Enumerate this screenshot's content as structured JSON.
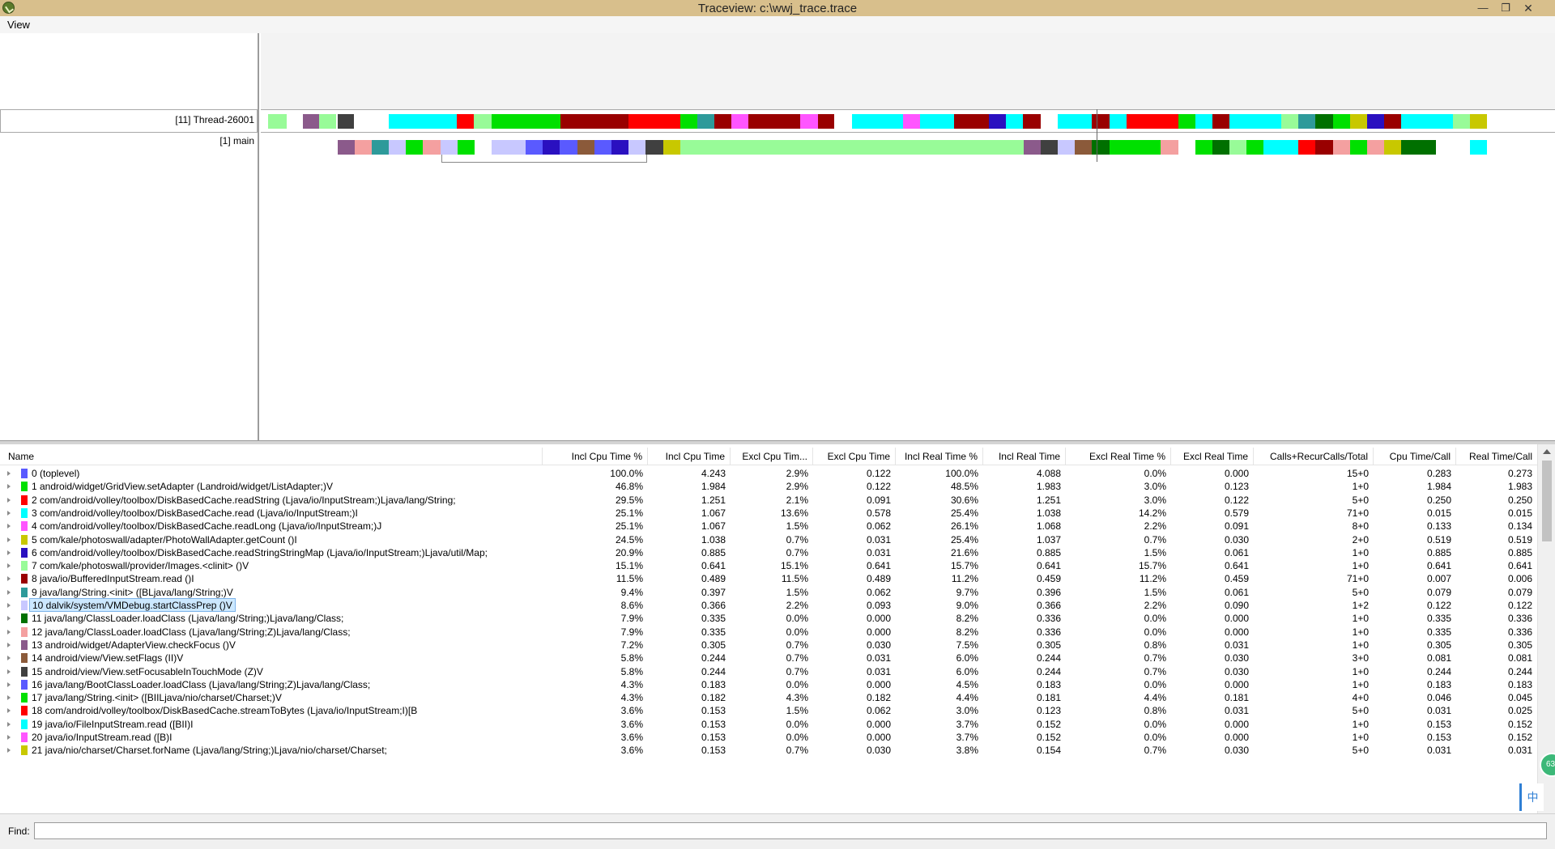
{
  "window": {
    "title": "Traceview: c:\\wwj_trace.trace",
    "minimize_glyph": "—",
    "maximize_glyph": "❐",
    "close_glyph": "✕",
    "app_icon": "android-traceview-icon"
  },
  "menu": {
    "items": [
      {
        "label": "View"
      }
    ]
  },
  "timeline": {
    "threads": [
      {
        "label": "[11] Thread-26001"
      },
      {
        "label": "[1] main"
      }
    ],
    "strip_colors": {
      "lime": "#98fb98",
      "purple": "#8b5a8b",
      "dark": "#404040",
      "cyan": "#00ffff",
      "red": "#ff0000",
      "green": "#00e000",
      "maroon": "#990000",
      "teal": "#2e9a9a",
      "magenta": "#ff55ff",
      "navy": "#2a10c0",
      "pink": "#f4a0a0",
      "lavender": "#c8c8ff",
      "blue": "#5a5aff",
      "brown": "#8b5a3a",
      "olive": "#c8c800",
      "darkgreen": "#007000"
    }
  },
  "table": {
    "headers": {
      "name": "Name",
      "incl_cpu_pct": "Incl Cpu Time %",
      "incl_cpu": "Incl Cpu Time",
      "excl_cpu_pct": "Excl Cpu Tim...",
      "excl_cpu": "Excl Cpu Time",
      "incl_real_pct": "Incl Real Time %",
      "incl_real": "Incl Real Time",
      "excl_real_pct": "Excl Real Time %",
      "excl_real": "Excl Real Time",
      "calls": "Calls+RecurCalls/Total",
      "cpu_per_call": "Cpu Time/Call",
      "real_per_call": "Real Time/Call"
    },
    "selected_index": 10,
    "rows": [
      {
        "name": "0 (toplevel)",
        "color": "#5a5aff",
        "v": [
          "100.0%",
          "4.243",
          "2.9%",
          "0.122",
          "100.0%",
          "4.088",
          "0.0%",
          "0.000",
          "15+0",
          "0.283",
          "0.273"
        ]
      },
      {
        "name": "1 android/widget/GridView.setAdapter (Landroid/widget/ListAdapter;)V",
        "color": "#00e000",
        "v": [
          "46.8%",
          "1.984",
          "2.9%",
          "0.122",
          "48.5%",
          "1.983",
          "3.0%",
          "0.123",
          "1+0",
          "1.984",
          "1.983"
        ]
      },
      {
        "name": "2 com/android/volley/toolbox/DiskBasedCache.readString (Ljava/io/InputStream;)Ljava/lang/String;",
        "color": "#ff0000",
        "v": [
          "29.5%",
          "1.251",
          "2.1%",
          "0.091",
          "30.6%",
          "1.251",
          "3.0%",
          "0.122",
          "5+0",
          "0.250",
          "0.250"
        ]
      },
      {
        "name": "3 com/android/volley/toolbox/DiskBasedCache.read (Ljava/io/InputStream;)I",
        "color": "#00ffff",
        "v": [
          "25.1%",
          "1.067",
          "13.6%",
          "0.578",
          "25.4%",
          "1.038",
          "14.2%",
          "0.579",
          "71+0",
          "0.015",
          "0.015"
        ]
      },
      {
        "name": "4 com/android/volley/toolbox/DiskBasedCache.readLong (Ljava/io/InputStream;)J",
        "color": "#ff55ff",
        "v": [
          "25.1%",
          "1.067",
          "1.5%",
          "0.062",
          "26.1%",
          "1.068",
          "2.2%",
          "0.091",
          "8+0",
          "0.133",
          "0.134"
        ]
      },
      {
        "name": "5 com/kale/photoswall/adapter/PhotoWallAdapter.getCount ()I",
        "color": "#c8c800",
        "v": [
          "24.5%",
          "1.038",
          "0.7%",
          "0.031",
          "25.4%",
          "1.037",
          "0.7%",
          "0.030",
          "2+0",
          "0.519",
          "0.519"
        ]
      },
      {
        "name": "6 com/android/volley/toolbox/DiskBasedCache.readStringStringMap (Ljava/io/InputStream;)Ljava/util/Map;",
        "color": "#2a10c0",
        "v": [
          "20.9%",
          "0.885",
          "0.7%",
          "0.031",
          "21.6%",
          "0.885",
          "1.5%",
          "0.061",
          "1+0",
          "0.885",
          "0.885"
        ]
      },
      {
        "name": "7 com/kale/photoswall/provider/Images.<clinit> ()V",
        "color": "#98fb98",
        "v": [
          "15.1%",
          "0.641",
          "15.1%",
          "0.641",
          "15.7%",
          "0.641",
          "15.7%",
          "0.641",
          "1+0",
          "0.641",
          "0.641"
        ]
      },
      {
        "name": "8 java/io/BufferedInputStream.read ()I",
        "color": "#990000",
        "v": [
          "11.5%",
          "0.489",
          "11.5%",
          "0.489",
          "11.2%",
          "0.459",
          "11.2%",
          "0.459",
          "71+0",
          "0.007",
          "0.006"
        ]
      },
      {
        "name": "9 java/lang/String.<init> ([BLjava/lang/String;)V",
        "color": "#2e9a9a",
        "v": [
          "9.4%",
          "0.397",
          "1.5%",
          "0.062",
          "9.7%",
          "0.396",
          "1.5%",
          "0.061",
          "5+0",
          "0.079",
          "0.079"
        ]
      },
      {
        "name": "10 dalvik/system/VMDebug.startClassPrep ()V",
        "color": "#c8c8ff",
        "v": [
          "8.6%",
          "0.366",
          "2.2%",
          "0.093",
          "9.0%",
          "0.366",
          "2.2%",
          "0.090",
          "1+2",
          "0.122",
          "0.122"
        ]
      },
      {
        "name": "11 java/lang/ClassLoader.loadClass (Ljava/lang/String;)Ljava/lang/Class;",
        "color": "#007000",
        "v": [
          "7.9%",
          "0.335",
          "0.0%",
          "0.000",
          "8.2%",
          "0.336",
          "0.0%",
          "0.000",
          "1+0",
          "0.335",
          "0.336"
        ]
      },
      {
        "name": "12 java/lang/ClassLoader.loadClass (Ljava/lang/String;Z)Ljava/lang/Class;",
        "color": "#f4a0a0",
        "v": [
          "7.9%",
          "0.335",
          "0.0%",
          "0.000",
          "8.2%",
          "0.336",
          "0.0%",
          "0.000",
          "1+0",
          "0.335",
          "0.336"
        ]
      },
      {
        "name": "13 android/widget/AdapterView.checkFocus ()V",
        "color": "#8b5a8b",
        "v": [
          "7.2%",
          "0.305",
          "0.7%",
          "0.030",
          "7.5%",
          "0.305",
          "0.8%",
          "0.031",
          "1+0",
          "0.305",
          "0.305"
        ]
      },
      {
        "name": "14 android/view/View.setFlags (II)V",
        "color": "#8b5a3a",
        "v": [
          "5.8%",
          "0.244",
          "0.7%",
          "0.031",
          "6.0%",
          "0.244",
          "0.7%",
          "0.030",
          "3+0",
          "0.081",
          "0.081"
        ]
      },
      {
        "name": "15 android/view/View.setFocusableInTouchMode (Z)V",
        "color": "#404040",
        "v": [
          "5.8%",
          "0.244",
          "0.7%",
          "0.031",
          "6.0%",
          "0.244",
          "0.7%",
          "0.030",
          "1+0",
          "0.244",
          "0.244"
        ]
      },
      {
        "name": "16 java/lang/BootClassLoader.loadClass (Ljava/lang/String;Z)Ljava/lang/Class;",
        "color": "#5a5aff",
        "v": [
          "4.3%",
          "0.183",
          "0.0%",
          "0.000",
          "4.5%",
          "0.183",
          "0.0%",
          "0.000",
          "1+0",
          "0.183",
          "0.183"
        ]
      },
      {
        "name": "17 java/lang/String.<init> ([BIILjava/nio/charset/Charset;)V",
        "color": "#00e000",
        "v": [
          "4.3%",
          "0.182",
          "4.3%",
          "0.182",
          "4.4%",
          "0.181",
          "4.4%",
          "0.181",
          "4+0",
          "0.046",
          "0.045"
        ]
      },
      {
        "name": "18 com/android/volley/toolbox/DiskBasedCache.streamToBytes (Ljava/io/InputStream;I)[B",
        "color": "#ff0000",
        "v": [
          "3.6%",
          "0.153",
          "1.5%",
          "0.062",
          "3.0%",
          "0.123",
          "0.8%",
          "0.031",
          "5+0",
          "0.031",
          "0.025"
        ]
      },
      {
        "name": "19 java/io/FileInputStream.read ([BII)I",
        "color": "#00ffff",
        "v": [
          "3.6%",
          "0.153",
          "0.0%",
          "0.000",
          "3.7%",
          "0.152",
          "0.0%",
          "0.000",
          "1+0",
          "0.153",
          "0.152"
        ]
      },
      {
        "name": "20 java/io/InputStream.read ([B)I",
        "color": "#ff55ff",
        "v": [
          "3.6%",
          "0.153",
          "0.0%",
          "0.000",
          "3.7%",
          "0.152",
          "0.0%",
          "0.000",
          "1+0",
          "0.153",
          "0.152"
        ]
      },
      {
        "name": "21 java/nio/charset/Charset.forName (Ljava/lang/String;)Ljava/nio/charset/Charset;",
        "color": "#c8c800",
        "v": [
          "3.6%",
          "0.153",
          "0.7%",
          "0.030",
          "3.8%",
          "0.154",
          "0.7%",
          "0.030",
          "5+0",
          "0.031",
          "0.031"
        ]
      }
    ]
  },
  "overlay": {
    "badge_text": "63",
    "ime_text": "中"
  },
  "find": {
    "label": "Find:",
    "value": "",
    "placeholder": ""
  }
}
